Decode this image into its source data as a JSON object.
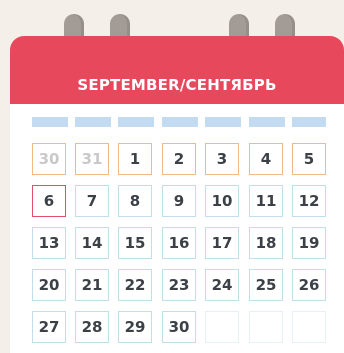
{
  "calendar": {
    "title": "SEPTEMBER/СЕНТЯБРЬ",
    "colors": {
      "header": "#e8485c",
      "ring": "#a39b95",
      "weekday_strip": "#c3dbf0",
      "cell_border": "#bfe0ea",
      "weekend_border": "#f0b985",
      "today_border": "#e0506a",
      "prev_month_text": "#c9c9c9",
      "day_text": "#3c4148"
    },
    "weeks": [
      [
        {
          "label": "30",
          "state": "prev"
        },
        {
          "label": "31",
          "state": "prev"
        },
        {
          "label": "1",
          "state": "hl"
        },
        {
          "label": "2",
          "state": "hl"
        },
        {
          "label": "3",
          "state": "hl"
        },
        {
          "label": "4",
          "state": "hl"
        },
        {
          "label": "5",
          "state": "hl"
        }
      ],
      [
        {
          "label": "6",
          "state": "today"
        },
        {
          "label": "7",
          "state": "normal"
        },
        {
          "label": "8",
          "state": "normal"
        },
        {
          "label": "9",
          "state": "normal"
        },
        {
          "label": "10",
          "state": "normal"
        },
        {
          "label": "11",
          "state": "normal"
        },
        {
          "label": "12",
          "state": "normal"
        }
      ],
      [
        {
          "label": "13",
          "state": "normal"
        },
        {
          "label": "14",
          "state": "normal"
        },
        {
          "label": "15",
          "state": "normal"
        },
        {
          "label": "16",
          "state": "normal"
        },
        {
          "label": "17",
          "state": "normal"
        },
        {
          "label": "18",
          "state": "normal"
        },
        {
          "label": "19",
          "state": "normal"
        }
      ],
      [
        {
          "label": "20",
          "state": "normal"
        },
        {
          "label": "21",
          "state": "normal"
        },
        {
          "label": "22",
          "state": "normal"
        },
        {
          "label": "23",
          "state": "normal"
        },
        {
          "label": "24",
          "state": "normal"
        },
        {
          "label": "25",
          "state": "normal"
        },
        {
          "label": "26",
          "state": "normal"
        }
      ],
      [
        {
          "label": "27",
          "state": "normal"
        },
        {
          "label": "28",
          "state": "normal"
        },
        {
          "label": "29",
          "state": "normal"
        },
        {
          "label": "30",
          "state": "normal"
        },
        {
          "label": "",
          "state": "blank"
        },
        {
          "label": "",
          "state": "blank"
        },
        {
          "label": "",
          "state": "blank"
        }
      ]
    ]
  }
}
